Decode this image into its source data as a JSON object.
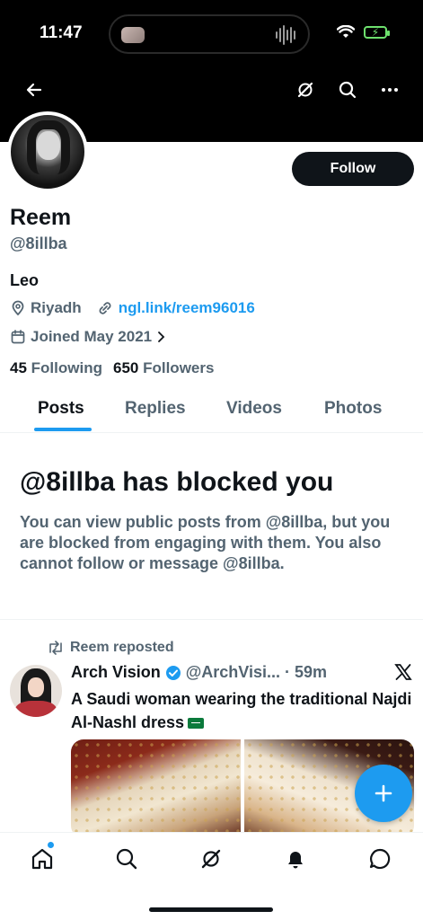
{
  "status_bar": {
    "time": "11:47"
  },
  "profile": {
    "name": "Reem",
    "handle": "@8illba",
    "bio": "Leo",
    "location": "Riyadh",
    "link": "ngl.link/reem96016",
    "joined": "Joined May 2021",
    "following_count": "45",
    "following_label": "Following",
    "followers_count": "650",
    "followers_label": "Followers",
    "follow_button": "Follow"
  },
  "tabs": [
    {
      "label": "Posts",
      "active": true
    },
    {
      "label": "Replies",
      "active": false
    },
    {
      "label": "Videos",
      "active": false
    },
    {
      "label": "Photos",
      "active": false
    }
  ],
  "blocked": {
    "title": "@8illba has blocked you",
    "message": "You can view public posts from @8illba, but you are blocked from engaging with them. You also cannot follow or message @8illba."
  },
  "post": {
    "repost_label": "Reem reposted",
    "author_name": "Arch Vision",
    "author_handle": "@ArchVisi...",
    "separator": "·",
    "time": "59m",
    "text": "A Saudi woman wearing the traditional Najdi Al-Nashl dress"
  },
  "colors": {
    "accent": "#1d9bf0",
    "text_primary": "#0f1419",
    "text_secondary": "#536471",
    "header_bg": "#000000"
  },
  "icons": {
    "back": "back-arrow-icon",
    "grok": "grok-icon",
    "search": "search-icon",
    "more": "more-icon",
    "location": "location-pin-icon",
    "link": "link-icon",
    "calendar": "calendar-icon",
    "repost": "repost-icon",
    "verified": "verified-badge-icon",
    "x": "x-logo-icon",
    "compose": "plus-icon",
    "home": "home-icon",
    "notifications": "bell-icon",
    "messages": "chat-icon"
  }
}
